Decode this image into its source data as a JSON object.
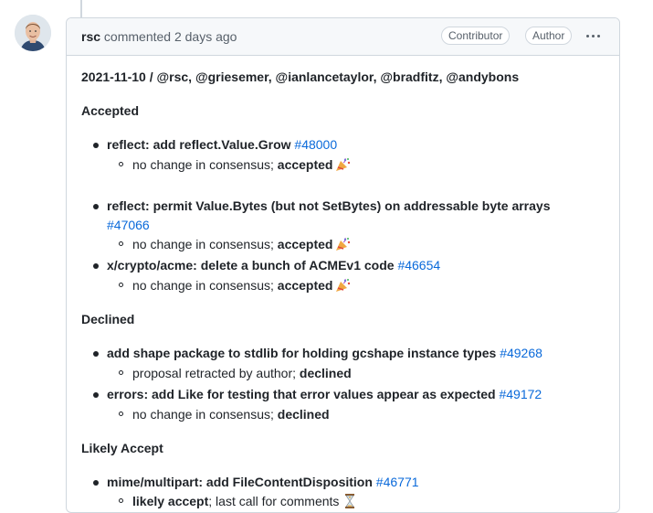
{
  "comment": {
    "author": "rsc",
    "action": "commented",
    "time": "2 days ago",
    "badges": [
      "Contributor",
      "Author"
    ],
    "menu_icon": "kebab-horizontal-icon"
  },
  "body": {
    "intro": "2021-11-10 / @rsc, @griesemer, @ianlancetaylor, @bradfitz, @andybons",
    "sections": [
      {
        "heading": "Accepted",
        "items": [
          {
            "title": "reflect: add reflect.Value.Grow",
            "issue": "#48000",
            "note_pre": "no change in consensus; ",
            "note_strong": "accepted",
            "note_post": "",
            "emoji": "party-popper-icon"
          },
          {
            "title": "reflect: permit Value.Bytes (but not SetBytes) on addressable byte arrays",
            "issue": "#47066",
            "note_pre": "no change in consensus; ",
            "note_strong": "accepted",
            "note_post": "",
            "emoji": "party-popper-icon"
          },
          {
            "title": "x/crypto/acme: delete a bunch of ACMEv1 code",
            "issue": "#46654",
            "note_pre": "no change in consensus; ",
            "note_strong": "accepted",
            "note_post": "",
            "emoji": "party-popper-icon"
          }
        ]
      },
      {
        "heading": "Declined",
        "items": [
          {
            "title": "add shape package to stdlib for holding gcshape instance types",
            "issue": "#49268",
            "note_pre": "proposal retracted by author; ",
            "note_strong": "declined",
            "note_post": ""
          },
          {
            "title": "errors: add Like for testing that error values appear as expected",
            "issue": "#49172",
            "note_pre": "no change in consensus; ",
            "note_strong": "declined",
            "note_post": ""
          }
        ]
      },
      {
        "heading": "Likely Accept",
        "items": [
          {
            "title": "mime/multipart: add FileContentDisposition",
            "issue": "#46771",
            "note_pre": "",
            "note_strong": "likely accept",
            "note_post": "; last call for comments",
            "emoji": "hourglass-icon"
          }
        ]
      }
    ]
  }
}
